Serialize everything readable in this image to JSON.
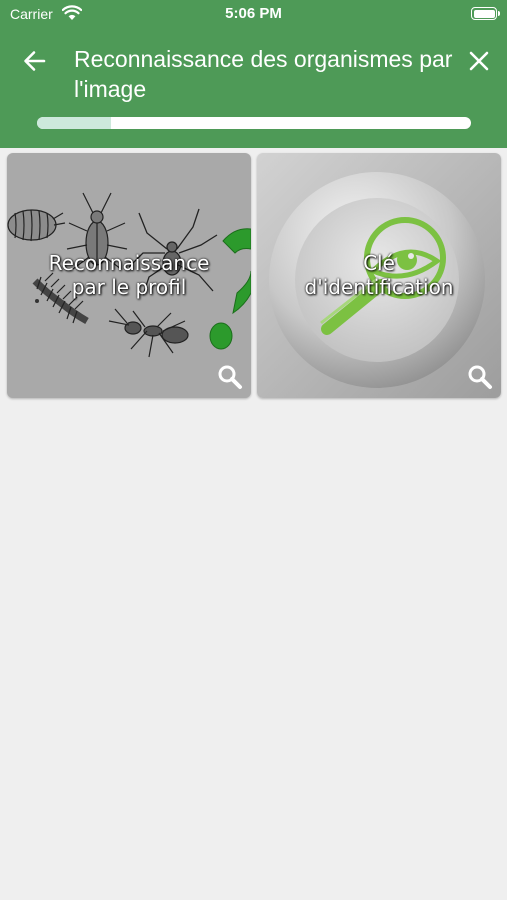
{
  "status_bar": {
    "carrier": "Carrier",
    "time": "5:06 PM"
  },
  "header": {
    "title": "Reconnaissance des organismes par l'image",
    "back_icon": "arrow-left-icon",
    "close_icon": "close-icon",
    "progress": 0.17,
    "bg_color": "#4e9a57"
  },
  "tiles": [
    {
      "label": "Reconnaissance\npar le profil",
      "icon": "search-icon"
    },
    {
      "label": "Clé\nd'identification",
      "icon": "search-icon"
    }
  ]
}
